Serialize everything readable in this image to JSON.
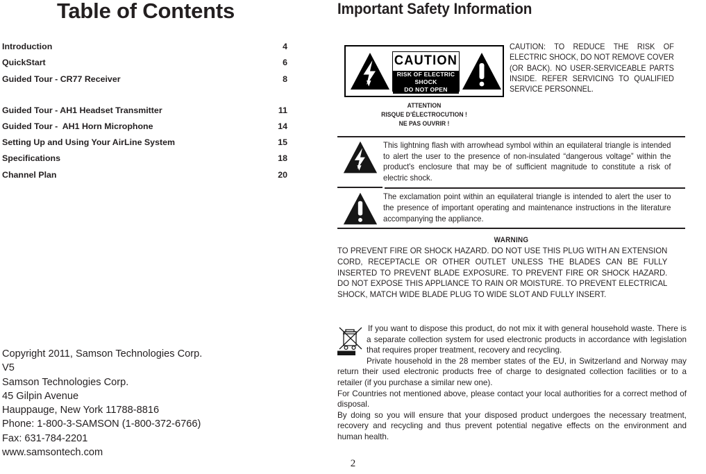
{
  "page": {
    "number": "2"
  },
  "left": {
    "title": "Table of Contents",
    "toc": [
      {
        "label": "Introduction",
        "page": "4"
      },
      {
        "label": "QuickStart",
        "page": "6"
      },
      {
        "label": "Guided Tour - CR77 Receiver",
        "page": "8"
      },
      {
        "label": "Guided Tour - AH1 Headset Transmitter",
        "page": "11"
      },
      {
        "label": "Guided Tour -  AH1 Horn Microphone",
        "page": "14"
      },
      {
        "label": "Setting Up and Using Your AirLine System",
        "page": "15"
      },
      {
        "label": "Specifications",
        "page": "18"
      },
      {
        "label": "Channel Plan",
        "page": "20"
      }
    ],
    "copyright": {
      "line1": "Copyright 2011, Samson Technologies Corp.",
      "line2": "V5",
      "line3": "Samson Technologies Corp.",
      "line4": "45 Gilpin Avenue",
      "line5": "Hauppauge, New York 11788-8816",
      "line6": "Phone: 1-800-3-SAMSON (1-800-372-6766)",
      "line7": "Fax: 631-784-2201",
      "line8": "www.samsontech.com"
    }
  },
  "right": {
    "title": "Important Safety Information",
    "emblem": {
      "caution_word": "CAUTION",
      "sub_line1": "RISK OF ELECTRIC SHOCK",
      "sub_line2": "DO NOT OPEN",
      "left_icon": "lightning-bolt-triangle-icon",
      "right_icon": "exclamation-triangle-icon"
    },
    "attention": {
      "line1": "ATTENTION",
      "line2": "RISQUE D’ÉLECTROCUTION !",
      "line3": "NE PAS OUVRIR !"
    },
    "caution_text": "CAUTION: TO REDUCE THE RISK OF ELECTRIC SHOCK, DO NOT REMOVE COVER (OR BACK). NO USER-SERVICEABLE PARTS INSIDE. REFER SERVICING TO QUALIFIED SERVICE PERSONNEL.",
    "symbols": [
      {
        "icon": "lightning-bolt-triangle-icon",
        "text": "This lightning flash with arrowhead symbol within an equilateral triangle is intended to alert the user to the presence of non-insulated “dangerous voltage” within the product's enclosure that may be of sufficient magnitude to constitute a risk of electric shock."
      },
      {
        "icon": "exclamation-triangle-icon",
        "text": "The exclamation point within an equilateral triangle is intended to alert the user to the presence of important operating and maintenance instructions in the literature accompanying the appliance."
      }
    ],
    "warning": {
      "heading": "WARNING",
      "body": "TO PREVENT FIRE OR SHOCK HAZARD. DO NOT USE THIS PLUG WITH AN EXTENSION CORD, RECEPTACLE OR OTHER OUTLET UNLESS THE BLADES CAN BE FULLY INSERTED TO PREVENT BLADE EXPOSURE. TO PREVENT FIRE OR SHOCK HAZARD. DO NOT EXPOSE THIS APPLIANCE TO RAIN OR MOISTURE. TO PREVENT ELECTRICAL SHOCK, MATCH WIDE BLADE PLUG TO WIDE SLOT AND FULLY INSERT."
    },
    "disposal": {
      "icon": "crossed-out-wheeled-bin-icon",
      "para1": "If you want to dispose this product, do not mix it with general household waste. There is a separate collection system for used electronic products in accordance with legislation that requires proper treatment, recovery and recycling.",
      "para2": "Private household in the 28 member states of the EU, in Switzerland and Norway may return their used electronic products free of charge to designated collection facilities or to a retailer (if you purchase a similar new one).",
      "para3": "For Countries not mentioned above, please contact your local authorities for a correct method of disposal.",
      "para4": "By doing so you will ensure that your disposed product undergoes the necessary treatment, recovery and recycling and thus prevent potential negative effects on the environment and human health."
    }
  }
}
